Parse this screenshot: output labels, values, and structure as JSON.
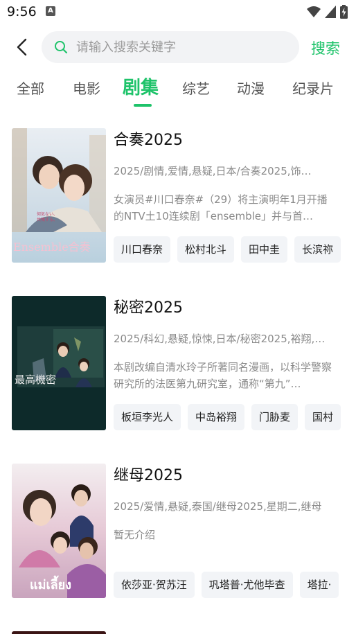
{
  "status": {
    "time": "9:56",
    "app_badge": "A"
  },
  "search": {
    "placeholder": "请输入搜索关键字",
    "value": "",
    "submit_label": "搜索"
  },
  "tabs": [
    {
      "label": "全部"
    },
    {
      "label": "电影"
    },
    {
      "label": "剧集",
      "active": true
    },
    {
      "label": "综艺"
    },
    {
      "label": "动漫"
    },
    {
      "label": "纪录片"
    }
  ],
  "results": [
    {
      "title": "合奏2025",
      "meta": "2025/剧情,爱情,悬疑,日本/合奏2025,饰…",
      "desc": "女演员#川口春奈#（29）将主演明年1月开播的NTV土10连续剧「ensemble」并与首…",
      "poster_text": "Ensemble合奏",
      "tags": [
        "川口春奈",
        "松村北斗",
        "田中圭",
        "长滨祢"
      ]
    },
    {
      "title": "秘密2025",
      "meta": "2025/科幻,悬疑,惊悚,日本/秘密2025,裕翔,…",
      "desc": "本剧改编自清水玲子所著同名漫画，以科学警察研究所的法医第九研究室，通称“第九”…",
      "poster_text": "最高機密",
      "tags": [
        "板垣李光人",
        "中岛裕翔",
        "门胁麦",
        "国村"
      ]
    },
    {
      "title": "继母2025",
      "meta": "2025/爱情,悬疑,泰国/继母2025,星期二,继母",
      "desc": "暂无介绍",
      "poster_text": "แม่เลี้ยง",
      "tags": [
        "依莎亚·贺苏汪",
        "巩塔普·尤他毕查",
        "塔拉·"
      ]
    }
  ],
  "colors": {
    "accent": "#1ec36a",
    "muted_text": "#8a8a8a",
    "tag_bg": "#f2f4f7",
    "search_bg": "#f2f3f5"
  }
}
